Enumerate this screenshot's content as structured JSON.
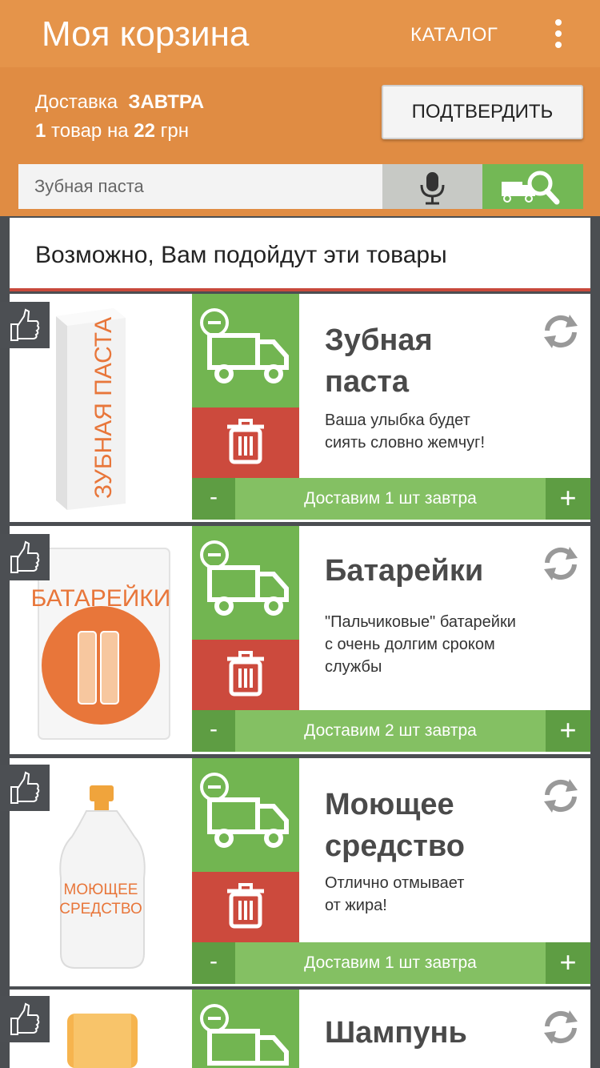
{
  "header": {
    "title": "Моя корзина",
    "catalog_label": "КАТАЛОГ",
    "delivery_prefix": "Доставка",
    "delivery_day": "ЗАВТРА",
    "items_count": "1",
    "items_mid": "товар на",
    "total": "22",
    "currency": "грн",
    "confirm_label": "ПОДТВЕРДИТЬ"
  },
  "search": {
    "placeholder": "Зубная паста"
  },
  "suggestions_title": "Возможно, Вам подойдут эти товары",
  "products": [
    {
      "name": "Зубная паста",
      "name_line1": "Зубная",
      "name_line2": "паста",
      "desc_line1": "Ваша улыбка будет",
      "desc_line2": "сиять словно жемчуг!",
      "desc_line3": "",
      "package_text": "ЗУБНАЯ ПАСТА",
      "qty_text": "Доставим 1 шт завтра",
      "minus": "-",
      "plus": "+"
    },
    {
      "name": "Батарейки",
      "name_line1": "Батарейки",
      "name_line2": "",
      "desc_line1": "\"Пальчиковые\" батарейки",
      "desc_line2": "с очень долгим сроком",
      "desc_line3": "службы",
      "package_text": "БАТАРЕЙКИ",
      "qty_text": "Доставим 2 шт завтра",
      "minus": "-",
      "plus": "+"
    },
    {
      "name": "Моющее средство",
      "name_line1": "Моющее",
      "name_line2": "средство",
      "desc_line1": "Отлично отмывает",
      "desc_line2": "от жира!",
      "desc_line3": "",
      "package_line1": "МОЮЩЕЕ",
      "package_line2": "СРЕДСТВО",
      "qty_text": "Доставим 1 шт завтра",
      "minus": "-",
      "plus": "+"
    },
    {
      "name": "Шампунь",
      "name_line1": "Шампунь",
      "name_line2": "",
      "desc_line1": "",
      "desc_line2": "",
      "desc_line3": ""
    }
  ],
  "colors": {
    "header_orange": "#e08c43",
    "green": "#72b551",
    "red": "#cc4a3d",
    "dark_bg": "#4b4e52",
    "product_orange": "#e8763a"
  }
}
